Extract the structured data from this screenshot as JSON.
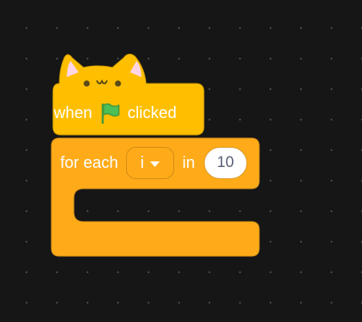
{
  "colors": {
    "background": "#161616",
    "events_block": "#ffbf00",
    "events_block_border": "#cc9900",
    "control_block": "#ffab19",
    "control_block_border": "#cf8b17",
    "cat_ear_inner": "#ffd5e6",
    "flag_green": "#4cbf56"
  },
  "hat_block": {
    "style": "cat-ears",
    "label_before": "when",
    "icon": "green-flag-icon",
    "label_after": "clicked"
  },
  "for_each_block": {
    "label": "for each",
    "variable": "i",
    "in_label": "in",
    "value": "10"
  }
}
